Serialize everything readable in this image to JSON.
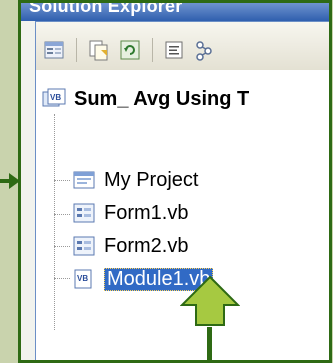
{
  "window": {
    "title": "Solution Explorer"
  },
  "toolbar": {
    "buttons": [
      {
        "icon": "properties-icon"
      },
      {
        "icon": "show-all-files-icon"
      },
      {
        "icon": "refresh-icon"
      },
      {
        "icon": "view-code-icon"
      },
      {
        "icon": "class-view-icon"
      }
    ]
  },
  "tree": {
    "root": {
      "label": "Sum_ Avg Using T",
      "icon": "vb-project-icon"
    },
    "items": [
      {
        "label": "My Project",
        "icon": "my-project-icon"
      },
      {
        "label": "Form1.vb",
        "icon": "form-icon"
      },
      {
        "label": "Form2.vb",
        "icon": "form-icon"
      },
      {
        "label": "Module1.vb",
        "icon": "vb-module-icon",
        "selected": true
      }
    ]
  },
  "colors": {
    "frame": "#2e6a14",
    "selection": "#316ac5",
    "arrow_fill": "#a6c941"
  }
}
